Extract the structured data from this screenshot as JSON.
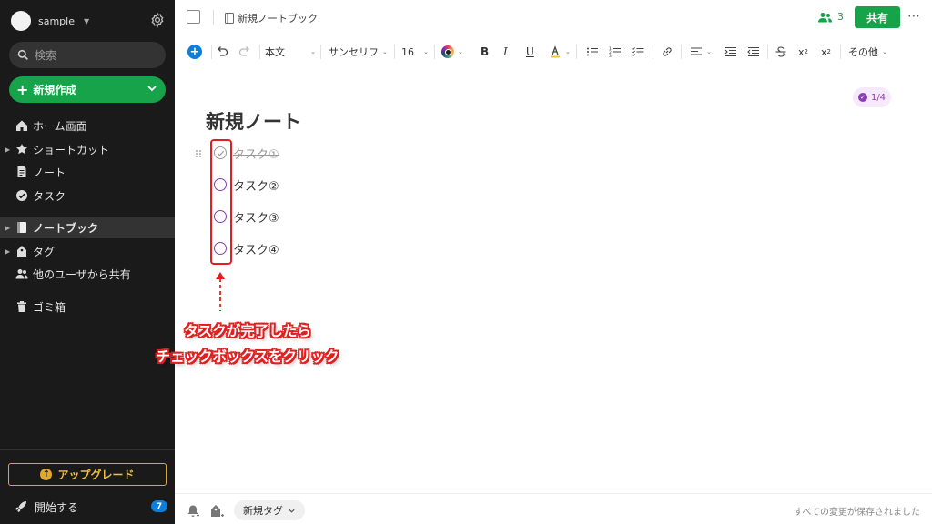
{
  "sidebar": {
    "account_name": "sample",
    "search_placeholder": "検索",
    "new_button_label": "新規作成",
    "nav": [
      {
        "label": "ホーム画面"
      },
      {
        "label": "ショートカット"
      },
      {
        "label": "ノート"
      },
      {
        "label": "タスク"
      },
      {
        "label": "ノートブック"
      },
      {
        "label": "タグ"
      },
      {
        "label": "他のユーザから共有"
      },
      {
        "label": "ゴミ箱"
      }
    ],
    "upgrade_label": "アップグレード",
    "start_label": "開始する",
    "start_badge": "7"
  },
  "topbar": {
    "notebook_name": "新規ノートブック",
    "share_count": "3",
    "share_label": "共有"
  },
  "toolbar": {
    "style": "本文",
    "font": "サンセリフ",
    "size": "16",
    "more_label": "その他"
  },
  "note": {
    "title": "新規ノート",
    "reminder_badge": "1/4",
    "tasks": [
      {
        "label": "タスク①",
        "done": true
      },
      {
        "label": "タスク②",
        "done": false
      },
      {
        "label": "タスク③",
        "done": false
      },
      {
        "label": "タスク④",
        "done": false
      }
    ]
  },
  "annotation": {
    "line1": "タスクが完了したら",
    "line2": "チェックボックスをクリック"
  },
  "footer": {
    "new_tag_label": "新規タグ",
    "saved_status": "すべての変更が保存されました"
  },
  "colors": {
    "accent_green": "#16a34a",
    "sidebar_bg": "#1a1a1a",
    "task_purple": "#8a3fb3",
    "annotation_red": "#e02020",
    "insert_blue": "#0b7fdb"
  }
}
